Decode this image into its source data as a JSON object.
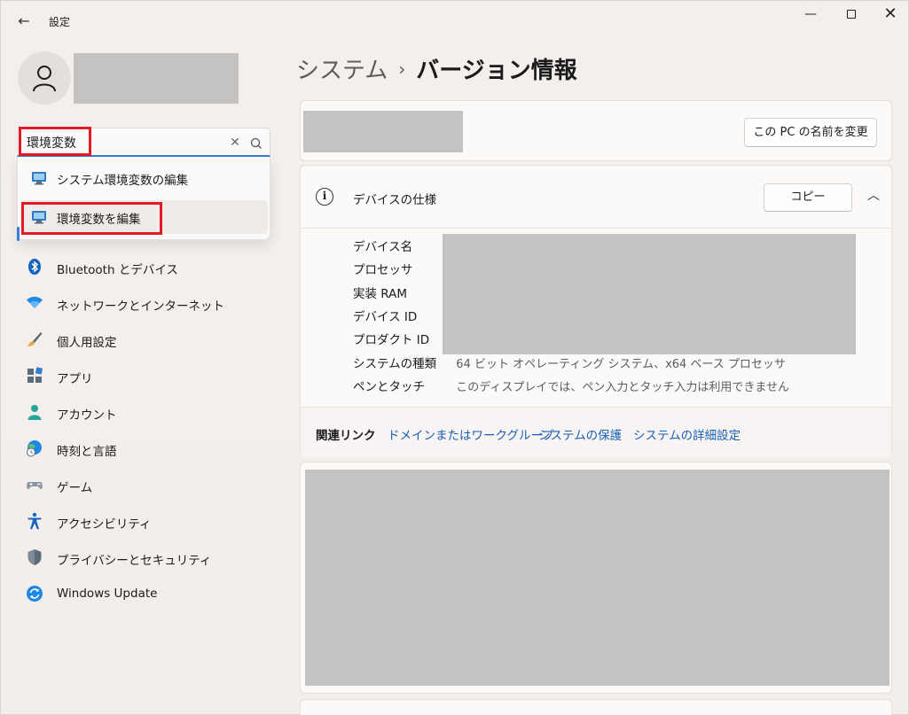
{
  "window": {
    "title": "設定"
  },
  "search": {
    "value": "環境変数"
  },
  "search_results": [
    {
      "label": "システム環境変数の編集"
    },
    {
      "label": "環境変数を編集"
    }
  ],
  "sidebar": {
    "items": [
      {
        "label": "Bluetooth とデバイス",
        "icon": "bluetooth-icon"
      },
      {
        "label": "ネットワークとインターネット",
        "icon": "wifi-icon"
      },
      {
        "label": "個人用設定",
        "icon": "brush-icon"
      },
      {
        "label": "アプリ",
        "icon": "apps-icon"
      },
      {
        "label": "アカウント",
        "icon": "account-icon"
      },
      {
        "label": "時刻と言語",
        "icon": "globe-clock-icon"
      },
      {
        "label": "ゲーム",
        "icon": "gamepad-icon"
      },
      {
        "label": "アクセシビリティ",
        "icon": "accessibility-icon"
      },
      {
        "label": "プライバシーとセキュリティ",
        "icon": "shield-icon"
      },
      {
        "label": "Windows Update",
        "icon": "update-icon"
      }
    ]
  },
  "breadcrumb": {
    "parent": "システム",
    "separator": "›",
    "current": "バージョン情報"
  },
  "pc_card": {
    "rename_label": "この PC の名前を変更"
  },
  "device_spec": {
    "title": "デバイスの仕様",
    "copy_label": "コピー",
    "rows": [
      {
        "label": "デバイス名",
        "value": ""
      },
      {
        "label": "プロセッサ",
        "value": ""
      },
      {
        "label": "実装 RAM",
        "value": ""
      },
      {
        "label": "デバイス ID",
        "value": ""
      },
      {
        "label": "プロダクト ID",
        "value": ""
      },
      {
        "label": "システムの種類",
        "value": "64 ビット オペレーティング システム、x64 ベース プロセッサ"
      },
      {
        "label": "ペンとタッチ",
        "value": "このディスプレイでは、ペン入力とタッチ入力は利用できません"
      }
    ]
  },
  "related_links": {
    "label": "関連リンク",
    "links": [
      "ドメインまたはワークグループ",
      "システムの保護",
      "システムの詳細設定"
    ]
  },
  "colors": {
    "accent": "#3a7bd5",
    "highlight": "#e01b24",
    "link": "#1a5fb4"
  }
}
